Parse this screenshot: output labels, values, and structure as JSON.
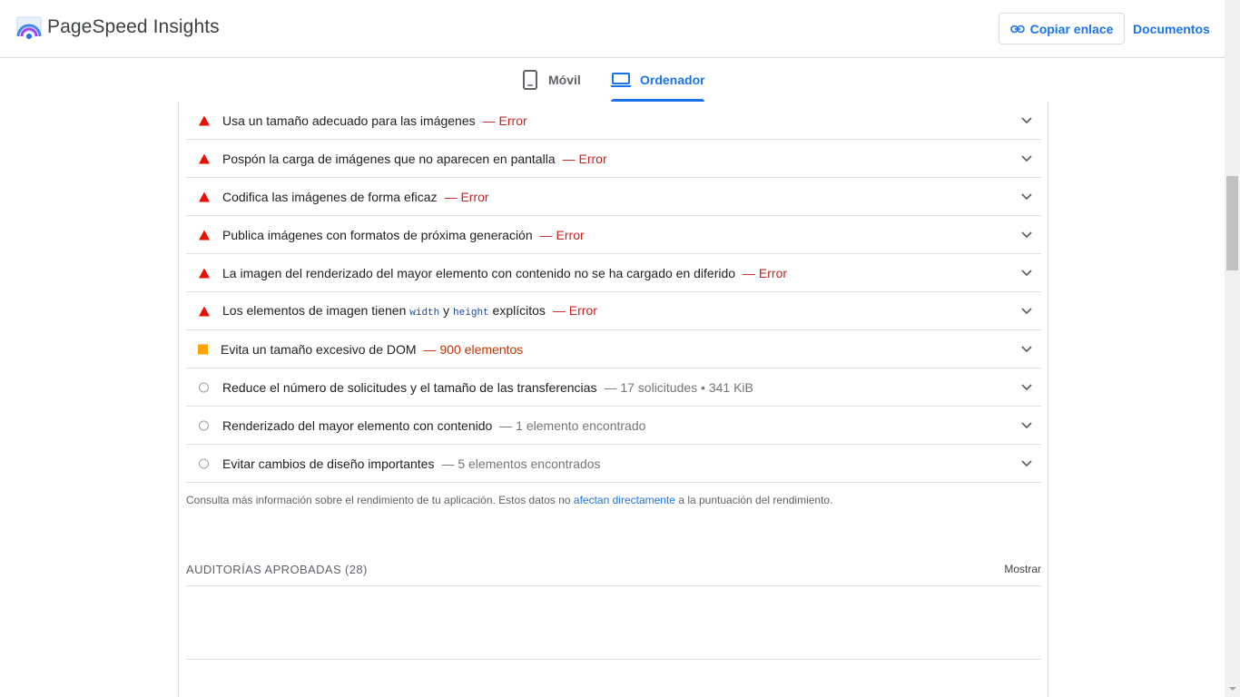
{
  "header": {
    "brand": "PageSpeed Insights",
    "copy_link": "Copiar enlace",
    "docs": "Documentos"
  },
  "tabs": [
    {
      "label": "Móvil",
      "icon": "phone-icon",
      "active": false
    },
    {
      "label": "Ordenador",
      "icon": "laptop-icon",
      "active": true
    }
  ],
  "audits": [
    {
      "title": "Usa un tamaño adecuado para las imágenes",
      "sep": "— Error",
      "status": "fail"
    },
    {
      "title": "Pospón la carga de imágenes que no aparecen en pantalla",
      "sep": "— Error",
      "status": "fail"
    },
    {
      "title": "Codifica las imágenes de forma eficaz",
      "sep": "— Error",
      "status": "fail"
    },
    {
      "title": "Publica imágenes con formatos de próxima generación",
      "sep": "— Error",
      "status": "fail"
    },
    {
      "title": "La imagen del renderizado del mayor elemento con contenido no se ha cargado en diferido",
      "sep": "— Error",
      "status": "fail"
    },
    {
      "title_pre": "Los elementos de imagen tienen",
      "code1": "width",
      "mid": "y",
      "code2": "height",
      "title_post": "explícitos",
      "sep": "— Error",
      "status": "fail"
    },
    {
      "title": "Evita un tamaño excesivo de DOM",
      "sep": "— 900 elementos",
      "status": "average"
    },
    {
      "title": "Reduce el número de solicitudes y el tamaño de las transferencias",
      "sep": "— 17 solicitudes • 341 KiB",
      "status": "info"
    },
    {
      "title": "Renderizado del mayor elemento con contenido",
      "sep": "— 1 elemento encontrado",
      "status": "info"
    },
    {
      "title": "Evitar cambios de diseño importantes",
      "sep": "— 5 elementos encontrados",
      "status": "info"
    }
  ],
  "info_text": {
    "pre": "Consulta más información sobre el rendimiento de tu aplicación. Estos datos no ",
    "link": "afectan directamente",
    "post": " a la puntuación del rendimiento."
  },
  "passed": {
    "title": "AUDITORÍAS APROBADAS",
    "count": "(28)",
    "show": "Mostrar"
  },
  "colors": {
    "fail": "#eb0f00",
    "average": "#ffa400",
    "info": "#9e9e9e",
    "accent": "#1a73e8",
    "error_text": "#c5221f",
    "average_text": "#c33300",
    "info_text": "#757575"
  }
}
